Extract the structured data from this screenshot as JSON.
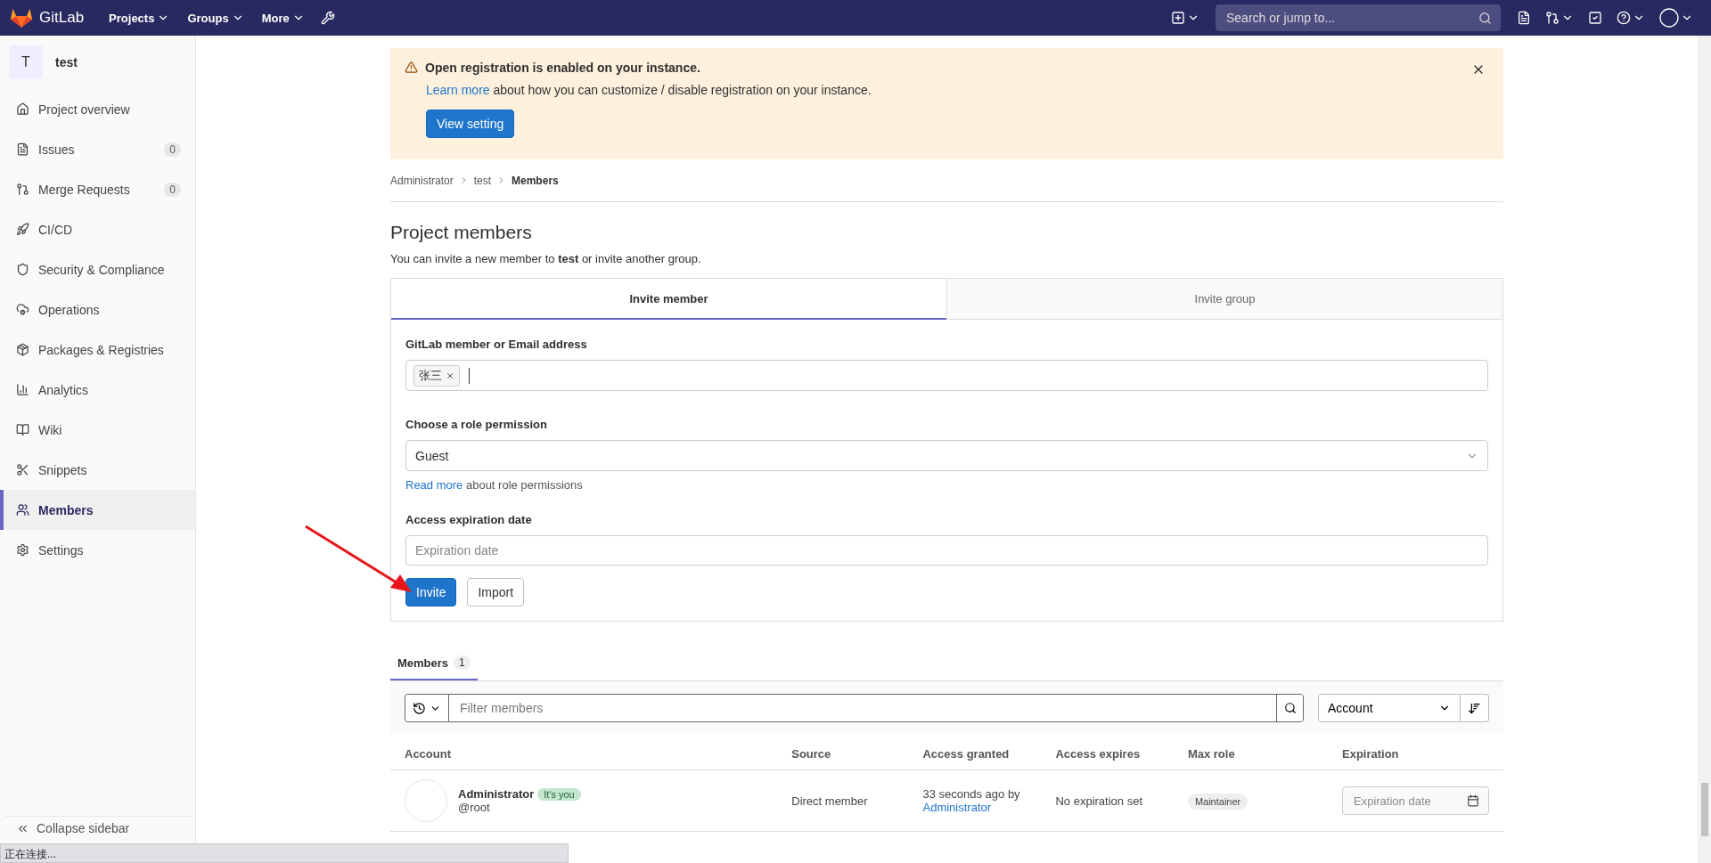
{
  "top_nav": {
    "logo_text": "GitLab",
    "menus": [
      {
        "label": "Projects"
      },
      {
        "label": "Groups"
      },
      {
        "label": "More"
      }
    ],
    "search": {
      "placeholder": "Search or jump to..."
    }
  },
  "sidebar": {
    "project": {
      "avatar": "T",
      "name": "test"
    },
    "items": [
      {
        "label": "Project overview",
        "selected": false
      },
      {
        "label": "Issues",
        "count": "0",
        "selected": false
      },
      {
        "label": "Merge Requests",
        "count": "0",
        "selected": false
      },
      {
        "label": "CI/CD",
        "selected": false
      },
      {
        "label": "Security & Compliance",
        "selected": false
      },
      {
        "label": "Operations",
        "selected": false
      },
      {
        "label": "Packages & Registries",
        "selected": false
      },
      {
        "label": "Analytics",
        "selected": false
      },
      {
        "label": "Wiki",
        "selected": false
      },
      {
        "label": "Snippets",
        "selected": false
      },
      {
        "label": "Members",
        "selected": true
      },
      {
        "label": "Settings",
        "selected": false
      }
    ],
    "collapse_label": "Collapse sidebar"
  },
  "alert": {
    "title": "Open registration is enabled on your instance.",
    "link": "Learn more",
    "text": "about how you can customize / disable registration on your instance.",
    "button": "View setting"
  },
  "breadcrumb": [
    {
      "label": "Administrator",
      "current": false
    },
    {
      "label": "test",
      "current": false
    },
    {
      "label": "Members",
      "current": true
    }
  ],
  "heading": "Project members",
  "intro": "You can invite a new member to **test** or invite another group.",
  "invite_tabs": [
    {
      "label": "Invite member",
      "selected": true
    },
    {
      "label": "Invite group",
      "selected": false
    }
  ],
  "form": {
    "member_label": "GitLab member or Email address",
    "tokens": [
      "张三"
    ],
    "role_label": "Choose a role permission",
    "role_value": "Guest",
    "role_help_link": "Read more",
    "role_help_text": "about role permissions",
    "expiry_label": "Access expiration date",
    "expiry_placeholder": "Expiration date",
    "buttons": [
      {
        "label": "Invite",
        "kind": "primary"
      },
      {
        "label": "Import",
        "kind": "default"
      }
    ]
  },
  "members_tab": {
    "label": "Members",
    "count": "1",
    "selected": true
  },
  "filter": {
    "placeholder": "Filter members",
    "sort_value": "Account"
  },
  "table": {
    "columns": [
      "Account",
      "Source",
      "Access granted",
      "Access expires",
      "Max role",
      "Expiration"
    ],
    "rows": [
      {
        "name": "Administrator",
        "badge": "It's you",
        "username": "@root",
        "source": "Direct member",
        "granted": "33 seconds ago by",
        "granted_by": "Administrator",
        "expires": "No expiration set",
        "max_role": "Maintainer",
        "expiration_placeholder": "Expiration date"
      }
    ]
  },
  "status_bar": {
    "text": "正在连接..."
  }
}
